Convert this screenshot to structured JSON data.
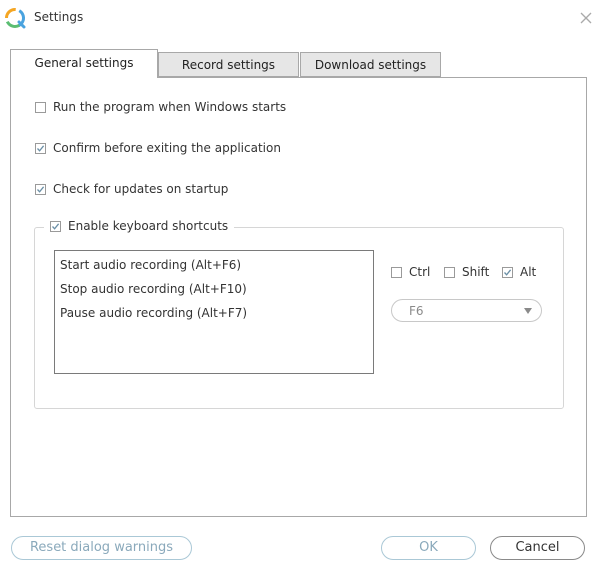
{
  "window": {
    "title": "Settings",
    "icons": {
      "app": "app-logo-icon",
      "close": "close-icon"
    }
  },
  "tabs": [
    {
      "label": "General settings",
      "active": true
    },
    {
      "label": "Record settings",
      "active": false
    },
    {
      "label": "Download settings",
      "active": false
    }
  ],
  "general": {
    "options": [
      {
        "label": "Run the program when Windows starts",
        "checked": false
      },
      {
        "label": "Confirm before exiting the application",
        "checked": true
      },
      {
        "label": "Check for updates on startup",
        "checked": true
      }
    ],
    "shortcuts": {
      "enable_label": "Enable keyboard shortcuts",
      "enabled": true,
      "items": [
        "Start audio recording (Alt+F6)",
        "Stop audio recording (Alt+F10)",
        "Pause audio recording (Alt+F7)"
      ],
      "modifiers": [
        {
          "label": "Ctrl",
          "checked": false
        },
        {
          "label": "Shift",
          "checked": false
        },
        {
          "label": "Alt",
          "checked": true
        }
      ],
      "key_select": {
        "value": "F6",
        "icon": "chevron-down-icon"
      }
    }
  },
  "footer": {
    "reset_label": "Reset dialog warnings",
    "ok_label": "OK",
    "cancel_label": "Cancel"
  },
  "colors": {
    "checkmark": "#6a8fa6",
    "disabled_button_text": "#8aa9bb",
    "tab_inactive_bg": "#e6e6e6"
  }
}
